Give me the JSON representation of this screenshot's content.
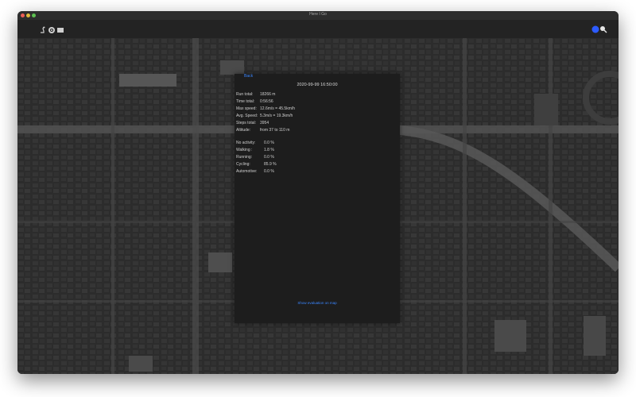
{
  "window": {
    "title": "Here I Go"
  },
  "toolbar": {
    "icons": [
      "walker-icon",
      "target-icon",
      "map-icon"
    ],
    "right_icons": [
      "location-dot-icon",
      "search-icon"
    ]
  },
  "panel": {
    "back_label": "Back",
    "title": "2020-99-99 16:50:00",
    "stats": [
      {
        "label": "Run total:",
        "value": "18266 m"
      },
      {
        "label": "Time total:",
        "value": "0:56:56"
      },
      {
        "label": "Max speed:",
        "value": "12.6m/s = 45.5km/h"
      },
      {
        "label": "Avg. Speed:",
        "value": "5.3m/s = 19.3km/h"
      },
      {
        "label": "Steps total:",
        "value": "3954"
      },
      {
        "label": "Altitude:",
        "value": "from 37 to 110 m"
      }
    ],
    "activities": [
      {
        "label": "No activity:",
        "value": "0.0 %"
      },
      {
        "label": "Walking :",
        "value": "1.8 %"
      },
      {
        "label": "Running:",
        "value": "0.0 %"
      },
      {
        "label": "Cycling:",
        "value": "85.9 %"
      },
      {
        "label": "Automotive:",
        "value": "0.0 %"
      }
    ],
    "show_link": "Show evaluation on map"
  },
  "colors": {
    "accent": "#3a86ff",
    "panel_bg": "#1d1d1d",
    "map_bg": "#2a2a2a"
  }
}
